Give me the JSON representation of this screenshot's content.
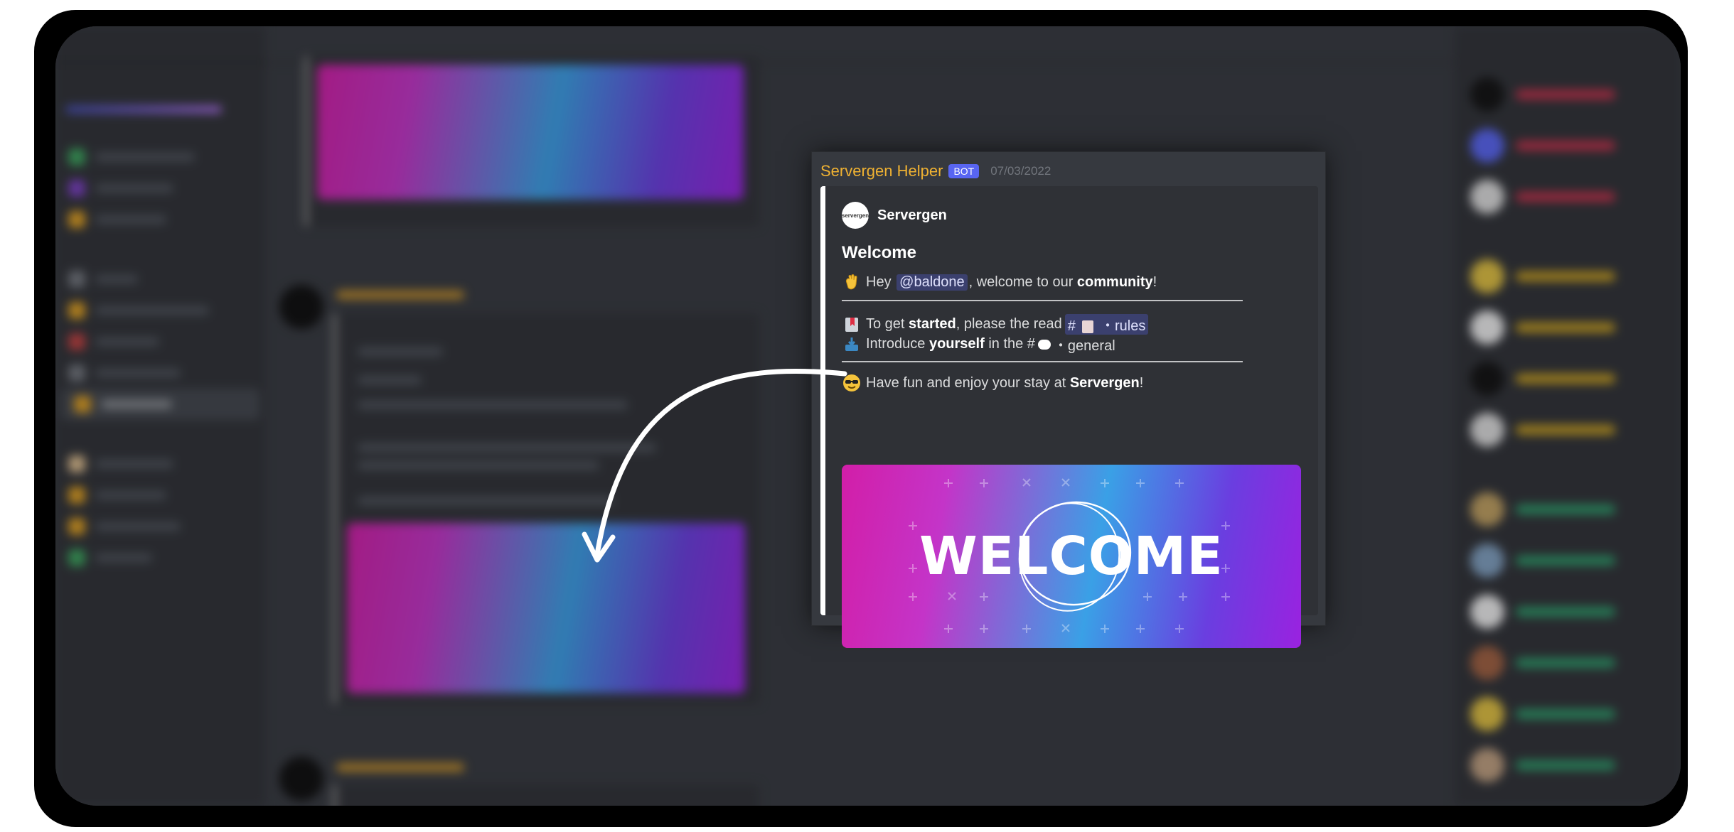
{
  "message": {
    "author": "Servergen Helper",
    "bot_tag": "BOT",
    "timestamp": "07/03/2022",
    "embed": {
      "author_name": "Servergen",
      "logo_text": "servergen",
      "title": "Welcome",
      "line1": {
        "emoji": "waving-hand",
        "hey": "Hey",
        "mention": "@baldone",
        "rest": ", welcome to our",
        "bold": "community",
        "end": "!"
      },
      "line2": {
        "emoji": "bookmark",
        "t1": "To get",
        "bold1": "started",
        "t2": ", please the read",
        "channel_hash": "#",
        "channel": "・rules"
      },
      "line3": {
        "emoji": "inbox-tray",
        "t1": "Introduce",
        "bold1": "yourself",
        "t2": "in the #",
        "channel": "・general"
      },
      "line4": {
        "emoji": "sunglasses-face",
        "t1": "Have fun and enjoy your stay at",
        "bold1": "Servergen",
        "end": "!"
      },
      "banner_text": "WELCOME"
    }
  },
  "colors": {
    "author": "#f0b232",
    "bot_tag": "#5865f2",
    "background": "#36393f",
    "embed_bg": "#2f3136"
  }
}
